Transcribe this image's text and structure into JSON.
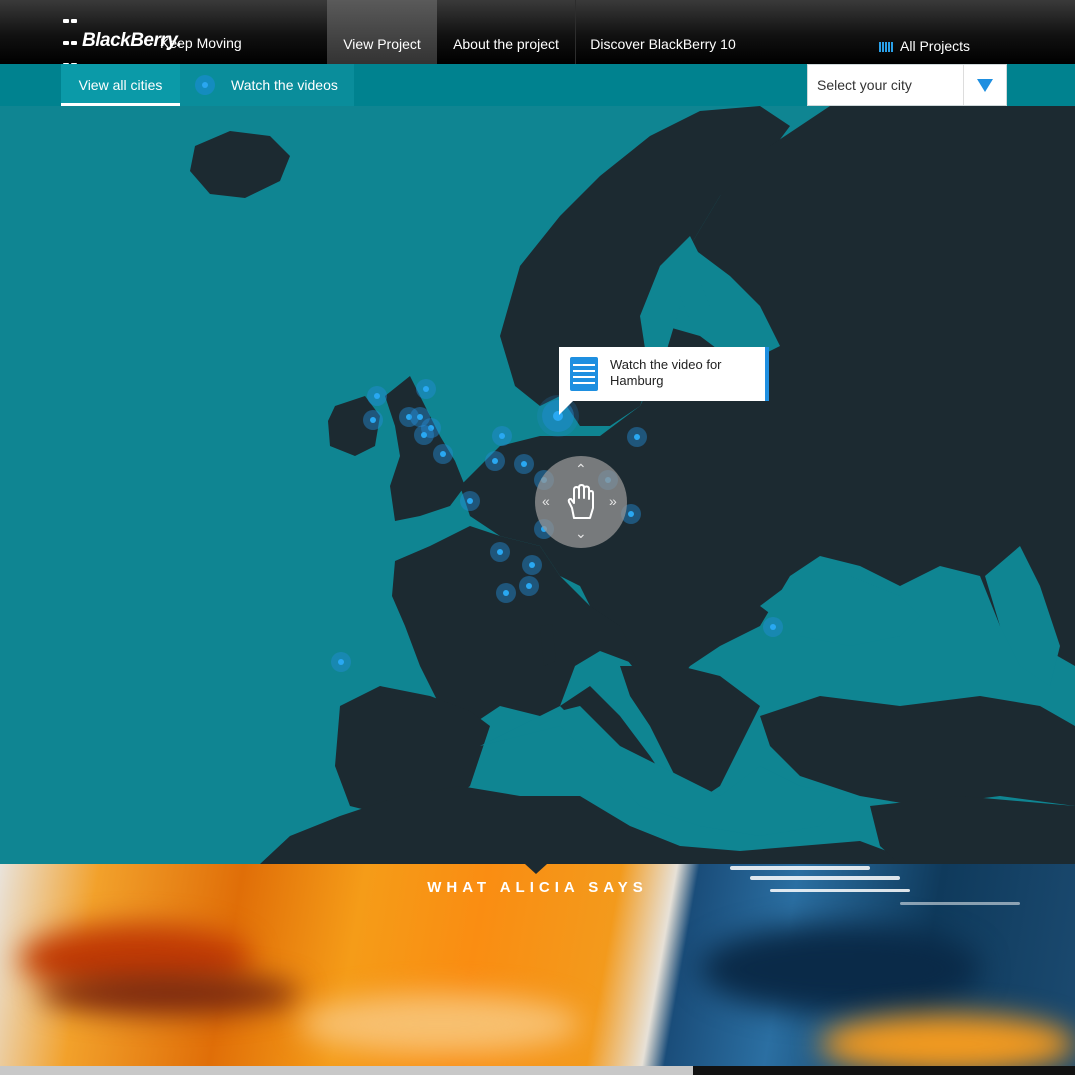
{
  "brand": {
    "logo": "BlackBerry.",
    "tagline": "Keep Moving"
  },
  "nav": {
    "items": [
      {
        "label": "View Project",
        "active": true
      },
      {
        "label": "About the project",
        "active": false
      },
      {
        "label": "Discover BlackBerry 10",
        "active": false
      }
    ],
    "all_projects": "All Projects"
  },
  "subnav": {
    "tabs": [
      {
        "label": "View all cities",
        "active": true
      },
      {
        "label": "Watch the videos",
        "active": false
      }
    ],
    "city_select": {
      "placeholder": "Select your city"
    }
  },
  "map": {
    "tooltip": "Watch the video for Hamburg",
    "pan_control": {
      "up": "⌃",
      "down": "⌄",
      "left": "«",
      "right": "»"
    }
  },
  "hero": {
    "title": "WHAT ALICIA SAYS"
  },
  "colors": {
    "accent": "#1e8fe0",
    "sea": "#0f8592",
    "land": "#1c2a31",
    "subbar": "#00828f"
  }
}
